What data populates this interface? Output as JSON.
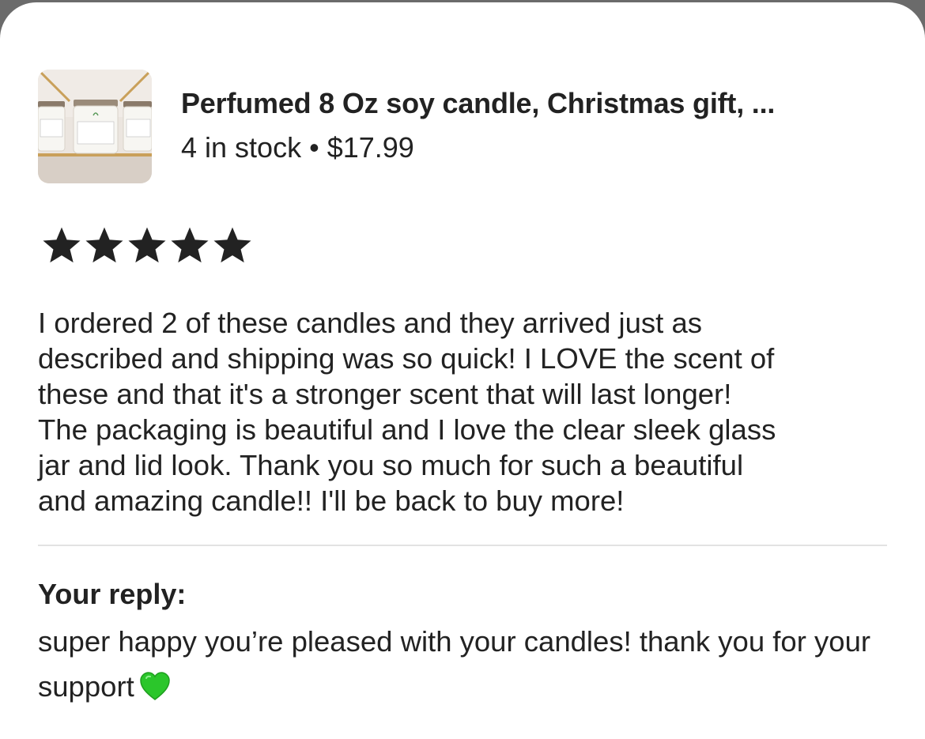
{
  "listing": {
    "title": "Perfumed 8 Oz soy candle, Christmas gift, ...",
    "stock": "4 in stock",
    "separator": "•",
    "price": "$17.99",
    "thumbnail_icon": "candle-jars-photo"
  },
  "review": {
    "rating": 5,
    "rating_max": 5,
    "star_color": "#222222",
    "text": "I ordered 2 of these candles and they arrived just as\ndescribed and shipping was so quick! I LOVE the scent of\nthese and that it's a stronger scent that will last longer!\nThe packaging is beautiful and I love the clear sleek glass\njar and lid look. Thank you so much for such a beautiful\nand amazing candle!! I'll be back to buy more!"
  },
  "reply": {
    "heading": "Your reply:",
    "text": "super happy you’re pleased with your candles! thank you for your support",
    "emoji": "green-heart-icon",
    "emoji_color": "#2bc62b"
  }
}
